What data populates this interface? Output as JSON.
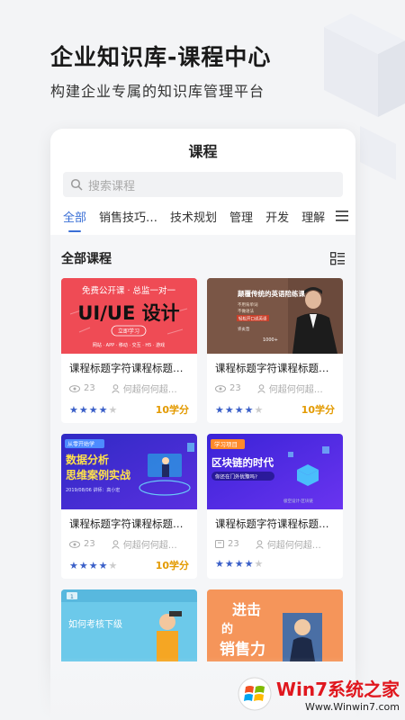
{
  "hero": {
    "title": "企业知识库-课程中心",
    "subtitle": "构建企业专属的知识库管理平台"
  },
  "app": {
    "header_title": "课程",
    "search_placeholder": "搜索课程",
    "tabs": [
      "全部",
      "销售技巧…",
      "技术规划",
      "管理",
      "开发",
      "理解"
    ],
    "active_tab": 0,
    "section_title": "全部课程"
  },
  "cards": [
    {
      "title": "课程标题字符课程标题字…",
      "views": "23",
      "author": "何超何何超…",
      "rating": 4,
      "credit": "10学分",
      "thumb": {
        "top": "免费公开课 · 总监一对一",
        "main": "UI/UE 设计",
        "tag": "立即学习",
        "bottom": "网站 · APP · 移动 · 交互 · H5 · 游戏"
      },
      "accent": "#ef4b55"
    },
    {
      "title": "课程标题字符课程标题字…",
      "views": "23",
      "author": "何超何何超…",
      "rating": 4,
      "credit": "10学分",
      "thumb": {
        "main": "颠覆传统的英语陪练课",
        "lines": [
          "不用背单词",
          "不做语法",
          "轻松开口说英语"
        ],
        "small": "许炎哲",
        "count": "1000+"
      },
      "accent": "#6b4a3c"
    },
    {
      "title": "课程标题字符课程标题字…",
      "views": "23",
      "author": "何超何何超…",
      "rating": 4,
      "credit": "10学分",
      "thumb": {
        "tag": "从零开始学",
        "main1": "数据分析",
        "main2": "思维案例实战",
        "bottom": "2019/08/06 讲师：高小宏"
      },
      "accent": "#3b2fd0"
    },
    {
      "title": "课程标题字符课程标题字…",
      "views": "23",
      "author": "何超何何超…",
      "rating": 4,
      "credit": "",
      "thumb": {
        "tag": "学习项目",
        "main": "区块链的时代",
        "sub": "你还在门外犹豫吗?",
        "tiny": "极空设计·区块链"
      },
      "accent": "#4a2bd8"
    }
  ],
  "partials": [
    {
      "text": "如何考核下级",
      "tag": "1"
    },
    {
      "text1": "进击",
      "text2": "的",
      "text3": "销售力"
    }
  ],
  "watermark": {
    "brand": "Win7系统之家",
    "url": "Www.Winwin7.com"
  },
  "colors": {
    "accent_blue": "#3a6fd6",
    "star_blue": "#3a5fc8",
    "credit_orange": "#e39a00"
  }
}
